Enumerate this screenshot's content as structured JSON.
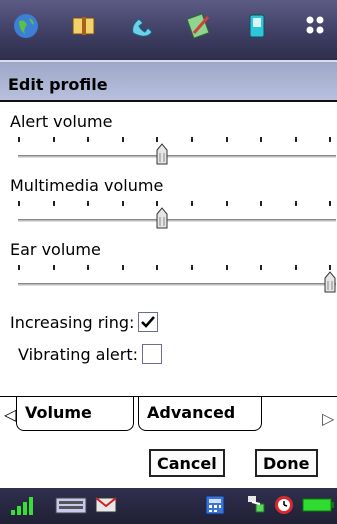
{
  "launcher": {
    "apps": [
      {
        "icon": "globe-icon"
      },
      {
        "icon": "book-icon"
      },
      {
        "icon": "phone-icon"
      },
      {
        "icon": "pen-notepad-icon"
      },
      {
        "icon": "device-icon"
      },
      {
        "icon": "grid-menu-icon"
      }
    ]
  },
  "dialog": {
    "title": "Edit profile",
    "alert_volume": {
      "label": "Alert volume",
      "level": 0.45
    },
    "multimedia_volume": {
      "label": "Multimedia volume",
      "level": 0.45
    },
    "ear_volume": {
      "label": "Ear volume",
      "level": 1.0
    },
    "increasing_ring": {
      "label": "Increasing ring:",
      "checked": true
    },
    "vibrating_alert": {
      "label": "Vibrating alert:",
      "checked": false
    },
    "tabs": [
      {
        "label": "Volume",
        "active": true
      },
      {
        "label": "Advanced",
        "active": false
      }
    ],
    "cancel_label": "Cancel",
    "done_label": "Done"
  },
  "statusbar": {
    "icons": [
      "signal-icon",
      "keyboard-icon",
      "mail-icon",
      "calculator-icon",
      "connection-icon",
      "alarm-icon",
      "battery-icon"
    ]
  },
  "colors": {
    "title_bg": "#aeb5d6",
    "launcher_bg": "#3d3d62",
    "statusbar_bg": "#26263f",
    "battery": "#2fdc2f"
  }
}
